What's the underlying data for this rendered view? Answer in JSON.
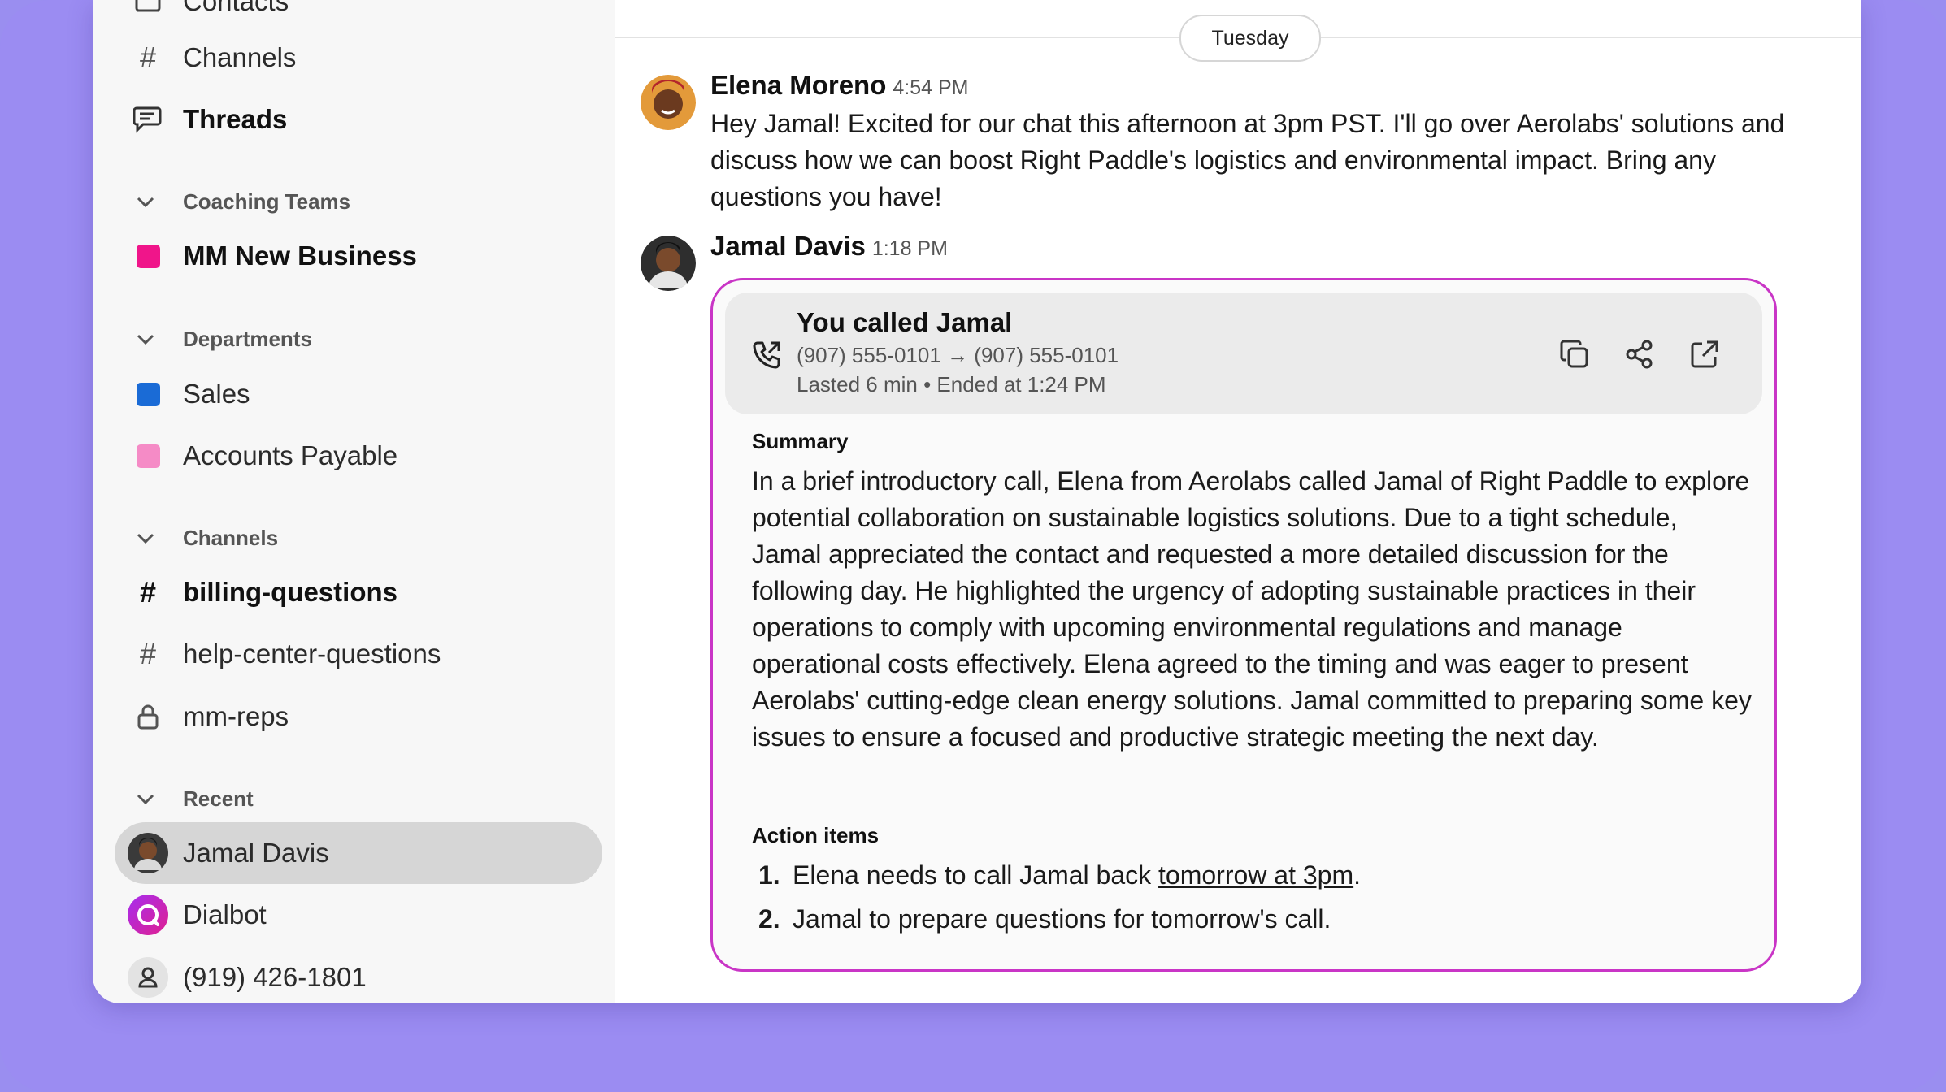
{
  "sidebar": {
    "top_items": [
      {
        "label": "Contacts",
        "icon": "contacts-icon"
      },
      {
        "label": "Channels",
        "icon": "hash-icon"
      },
      {
        "label": "Threads",
        "icon": "threads-icon"
      }
    ],
    "sections": [
      {
        "title": "Coaching Teams",
        "items": [
          {
            "label": "MM New Business",
            "color": "#f0158a"
          }
        ]
      },
      {
        "title": "Departments",
        "items": [
          {
            "label": "Sales",
            "color": "#1a6bd6"
          },
          {
            "label": "Accounts Payable",
            "color": "#f58bc6"
          }
        ]
      },
      {
        "title": "Channels",
        "items": [
          {
            "label": "billing-questions"
          },
          {
            "label": "help-center-questions"
          },
          {
            "label": "mm-reps"
          }
        ]
      },
      {
        "title": "Recent",
        "items": [
          {
            "label": "Jamal Davis"
          },
          {
            "label": "Dialbot"
          },
          {
            "label": "(919) 426-1801"
          }
        ]
      }
    ]
  },
  "main": {
    "date_divider": "Tuesday",
    "messages": [
      {
        "author": "Elena Moreno",
        "time": "4:54 PM",
        "text": "Hey Jamal! Excited for our chat this afternoon at 3pm PST. I'll go over Aerolabs' solutions and discuss how we can boost Right Paddle's logistics and environmental impact. Bring any questions you have!"
      },
      {
        "author": "Jamal Davis",
        "time": "1:18 PM"
      }
    ],
    "call_card": {
      "title": "You called Jamal",
      "from_number": "(907) 555-0101",
      "arrow": "→",
      "to_number": "(907) 555-0101",
      "meta": "Lasted 6 min • Ended at 1:24 PM",
      "summary_heading": "Summary",
      "summary": "In a brief introductory call, Elena from Aerolabs called Jamal of Right Paddle to explore potential collaboration on sustainable logistics solutions. Due to a tight schedule, Jamal appreciated the contact and requested a more detailed discussion for the following day. He highlighted the urgency of adopting sustainable practices in their operations to comply with upcoming environmental regulations and manage operational costs effectively. Elena agreed to the timing and was eager to present Aerolabs' cutting-edge clean energy solutions. Jamal committed to preparing some key issues to ensure a focused and productive strategic meeting the next day.",
      "action_heading": "Action items",
      "action_items": [
        {
          "num": "1.",
          "pre": "Elena needs to call Jamal back ",
          "link": "tomorrow at 3pm",
          "post": "."
        },
        {
          "num": "2.",
          "pre": "Jamal to prepare questions for tomorrow's call.",
          "link": "",
          "post": ""
        }
      ]
    }
  },
  "colors": {
    "accent_border": "#c935c6",
    "background": "#9b8cf2",
    "dialbot": "#c020c8"
  }
}
